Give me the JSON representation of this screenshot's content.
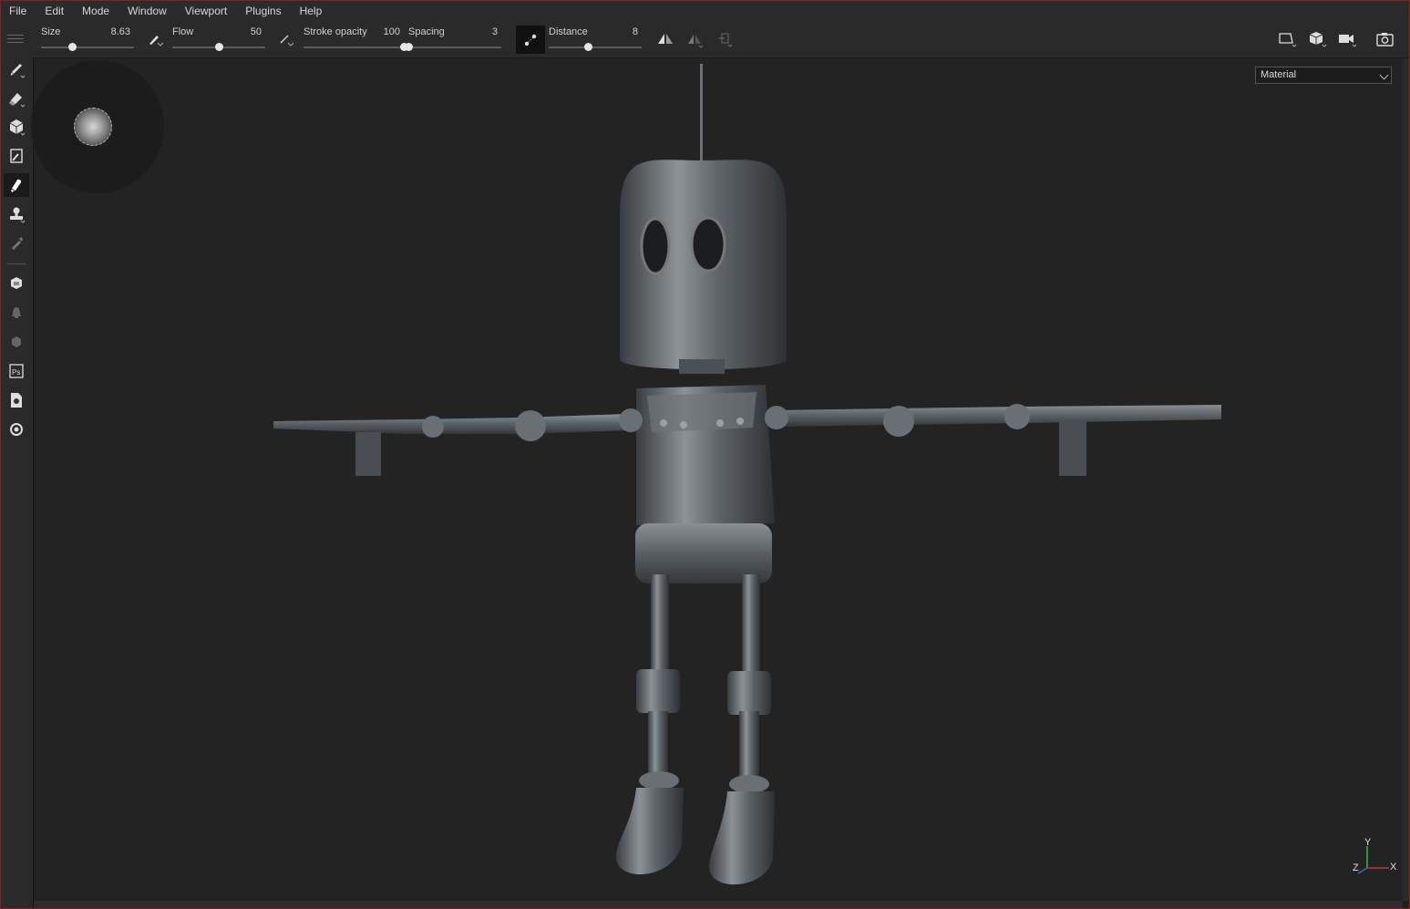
{
  "menu": [
    "File",
    "Edit",
    "Mode",
    "Window",
    "Viewport",
    "Plugins",
    "Help"
  ],
  "toolbar": {
    "size": {
      "label": "Size",
      "value": "8.63",
      "fraction": 0.33
    },
    "flow": {
      "label": "Flow",
      "value": "50",
      "fraction": 0.5
    },
    "stroke_opacity": {
      "label": "Stroke opacity",
      "value": "100",
      "fraction": 1.0
    },
    "spacing": {
      "label": "Spacing",
      "value": "3",
      "fraction": 0.0
    },
    "distance": {
      "label": "Distance",
      "value": "8",
      "fraction": 0.42
    }
  },
  "left_tools": [
    "paint-brush-icon",
    "eraser-icon",
    "projection-icon",
    "geometry-fill-icon",
    "smudge-icon",
    "clone-stamp-icon",
    "color-picker-icon",
    "bake-icon",
    "physical-paint-icon",
    "particle-icon",
    "photoshop-icon",
    "export-icon",
    "settings-icon"
  ],
  "viewport": {
    "display_mode": "Material",
    "axis_labels": {
      "x": "X",
      "y": "Y",
      "z": "Z"
    }
  },
  "colors": {
    "accent_border": "#8a2020",
    "background": "#232323",
    "panel": "#2a2a2a"
  }
}
